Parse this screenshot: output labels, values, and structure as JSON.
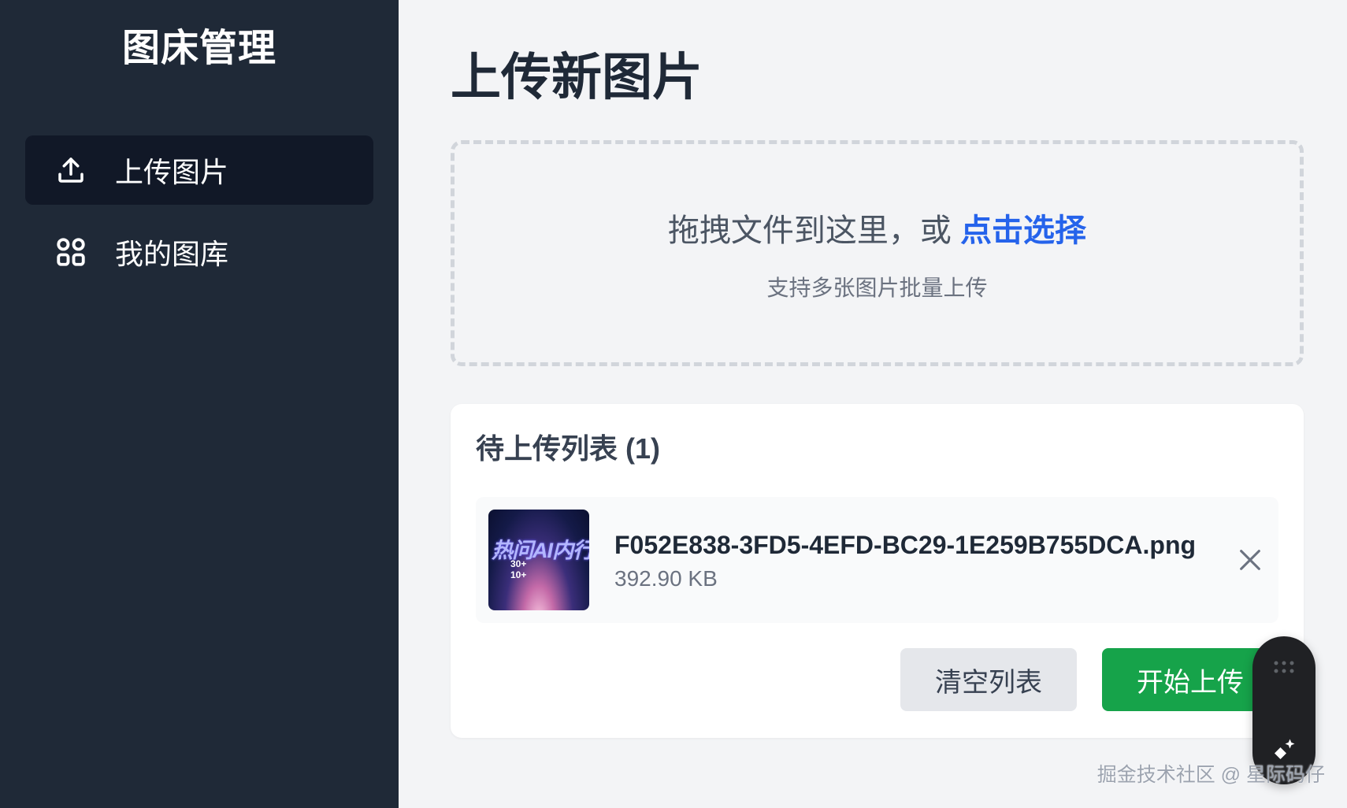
{
  "sidebar": {
    "brand": "图床管理",
    "items": [
      {
        "label": "上传图片",
        "icon": "upload-icon",
        "active": true
      },
      {
        "label": "我的图库",
        "icon": "grid-icon",
        "active": false
      }
    ]
  },
  "main": {
    "title": "上传新图片",
    "dropzone": {
      "text": "拖拽文件到这里，或",
      "link": "点击选择",
      "hint": "支持多张图片批量上传"
    },
    "queue": {
      "title": "待上传列表 (1)",
      "files": [
        {
          "name": "F052E838-3FD5-4EFD-BC29-1E259B755DCA.png",
          "size": "392.90 KB",
          "thumb_text": [
            "热问AI内行人",
            "30+",
            "10+"
          ]
        }
      ],
      "clear_label": "清空列表",
      "start_label": "开始上传"
    }
  },
  "widget": {
    "top_icon": "drag-handle-icon",
    "bottom_icon": "sparkle-icon"
  },
  "watermark": "掘金技术社区 @ 星际码仔",
  "colors": {
    "sidebar_bg": "#1f2937",
    "active_item_bg": "#111827",
    "link": "#2563eb",
    "start_button": "#16a34a",
    "clear_button": "#e5e7eb"
  }
}
